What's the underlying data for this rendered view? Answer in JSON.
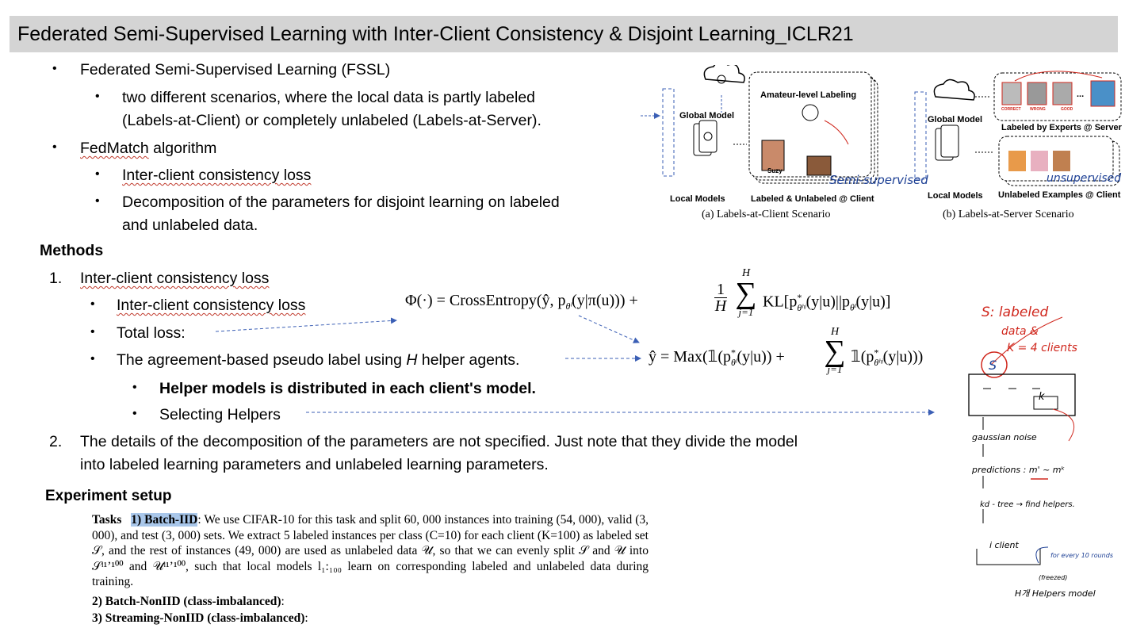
{
  "title": "Federated Semi-Supervised Learning with Inter-Client Consistency & Disjoint Learning_ICLR21",
  "bullets": {
    "fssl": "Federated Semi-Supervised Learning (FSSL)",
    "scenario_line1": "two different scenarios, where the local data is partly labeled",
    "scenario_line2": "(Labels-at-Client) or completely unlabeled (Labels-at-Server).",
    "fedmatch_name": "FedMatch",
    "fedmatch_rest": " algorithm",
    "inter_client": "Inter-client consistency loss",
    "decomp_line1": "Decomposition of the parameters for disjoint learning on labeled",
    "decomp_line2": "and unlabeled data."
  },
  "methods": {
    "heading": "Methods",
    "item1_num": "1.",
    "item1": "Inter-client consistency loss",
    "sub_inter": "Inter-client consistency loss",
    "sub_total": "Total loss:",
    "sub_agree_pre": "The agreement-based pseudo label using ",
    "sub_agree_h": "H",
    "sub_agree_post": " helper agents.",
    "helper_distributed": "Helper models is distributed in each client's model.",
    "selecting_helpers": "Selecting Helpers",
    "item2_num": "2.",
    "item2_line1": "The details of the decomposition of the parameters are not specified. Just note that they divide the model",
    "item2_line2": "into labeled learning parameters and unlabeled learning parameters."
  },
  "equations": {
    "phi_left": "Φ(·) = CrossEntropy(ŷ, p",
    "phi_mid": "(y|π(u))) +",
    "frac_num": "1",
    "frac_den": "H",
    "sum_top": "H",
    "sum_bot": "j=1",
    "kl": "KL[p",
    "kl_mid": "(y|u)||p",
    "kl_end": "(y|u)]",
    "yhat": "ŷ = Max(𝟙(p",
    "yhat_mid": "(y|u)) +",
    "yhat_end": "𝟙(p",
    "yhat_tail": "(y|u)))",
    "sub_theta_l": "θˡ",
    "sub_theta_h": "θʰʲ",
    "star": "*"
  },
  "experiment": {
    "heading": "Experiment setup",
    "tasks_label": "Tasks",
    "batch_iid": "1) Batch-IID",
    "tasks_text": ": We use CIFAR-10 for this task and split 60, 000 instances into training (54, 000), valid (3, 000), and test (3, 000) sets. We extract 5 labeled instances per class (C=10) for each client (K=100) as labeled set 𝒮, and the rest of instances (49, 000) are used as unlabeled data 𝒰, so that we can evenly split 𝒮 and 𝒰 into 𝒮ˡ¹ʼ¹⁰⁰ and 𝒰ˡ¹ʼ¹⁰⁰, such that local models l₁:₁₀₀ learn on corresponding labeled and unlabeled data during training.",
    "batch_noniid": "2) Batch-NonIID (class-imbalanced)",
    "stream_noniid": "3) Streaming-NonIID (class-imbalanced)",
    "colon": ":"
  },
  "figure": {
    "global_model": "Global Model",
    "local_models": "Local Models",
    "amateur": "Amateur-level Labeling",
    "suzy": "Suzy",
    "labeled_unlabeled": "Labeled & Unlabeled @ Client",
    "caption_a": "(a) Labels-at-Client Scenario",
    "labeled_experts": "Labeled by Experts @ Server",
    "correct": "CORRECT",
    "wrong": "WRONG",
    "good": "GOOD",
    "ellipsis": "...",
    "unlabeled_examples": "Unlabeled Examples @ Client",
    "caption_b": "(b) Labels-at-Server Scenario",
    "handwritten_semi": "Semi-supervised",
    "handwritten_unsup": "unsupervised"
  },
  "notes": {
    "s_labeled": "S: labeled",
    "data_and": "data &",
    "k_clients": "K = 4 clients",
    "s_letter": "S",
    "k_letter": "k",
    "gaussian": "gaussian noise",
    "predictions": "predictions :  m' ~ mᵏ",
    "kdtree": "kd - tree → find helpers.",
    "client": "i client",
    "every10": "for every 10 rounds",
    "freezed": "(freezed)",
    "helpers_model": "H개 Helpers model"
  },
  "colors": {
    "titlebar": "#d4d4d4",
    "arrow": "#3b5fb5",
    "ink_red": "#d0281e",
    "ink_blue": "#1c3f94"
  }
}
